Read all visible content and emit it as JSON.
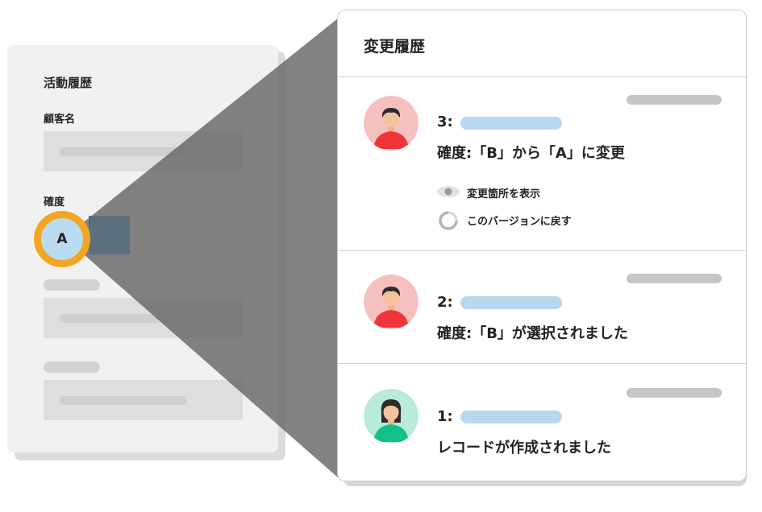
{
  "left_form": {
    "heading": "活動履歴",
    "customer_label": "顧客名",
    "rating_label": "確度",
    "rating_badge": "A"
  },
  "history": {
    "title": "変更履歴",
    "entries": [
      {
        "number": "3:",
        "message": "確度:「B」から「A」に変更",
        "avatar": "male-user",
        "actions": [
          {
            "label": "変更箇所を表示",
            "icon": "eye-icon"
          },
          {
            "label": "このバージョンに戻す",
            "icon": "revert-icon"
          }
        ]
      },
      {
        "number": "2:",
        "message": "確度:「B」が選択されました",
        "avatar": "male-user"
      },
      {
        "number": "1:",
        "message": "レコードが作成されました",
        "avatar": "female-user"
      }
    ]
  },
  "colors": {
    "badge_ring": "#f4a623",
    "badge_fill": "#b9dcf1",
    "user_pill": "#b7d8ef",
    "male_avatar_bg": "#f7c0c0",
    "male_shirt": "#f0353a",
    "female_avatar_bg": "#b8ecd8",
    "female_shirt": "#12c08a"
  }
}
